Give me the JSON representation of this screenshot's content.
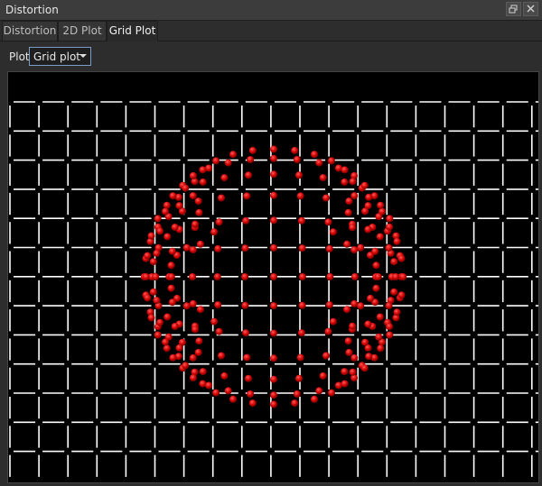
{
  "window": {
    "title": "Distortion",
    "restore_icon": "restore-icon",
    "close_icon": "close-icon"
  },
  "tabs": [
    {
      "label": "Distortion",
      "active": false
    },
    {
      "label": "2D Plot",
      "active": false
    },
    {
      "label": "Grid Plot",
      "active": true
    }
  ],
  "toolbar": {
    "plot_label": "Plot",
    "plot_select_value": "Grid plot",
    "plot_select_icon": "chevron-down-icon"
  },
  "plot": {
    "background": "#000000",
    "reference_grid_color": "#ffffff",
    "distorted_point_color": "#dd0000",
    "grid_columns": 19,
    "grid_rows": 13,
    "distortion": "barrel",
    "points_inside_circle": true
  }
}
